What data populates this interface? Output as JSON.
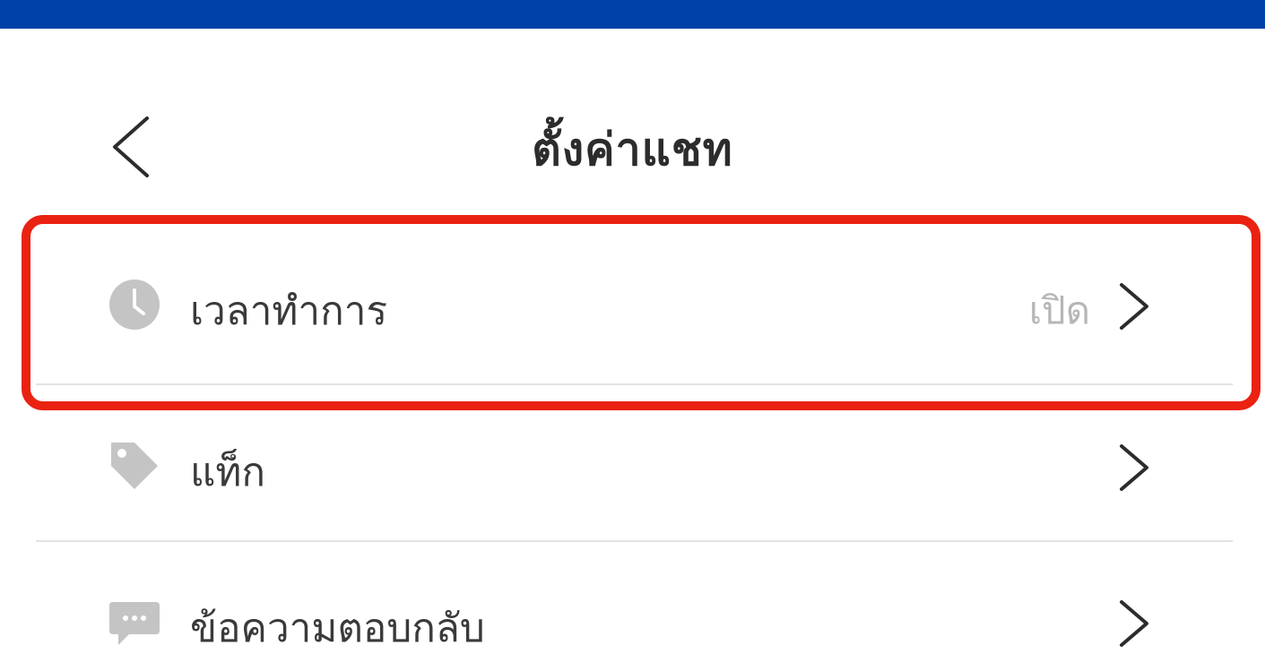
{
  "header": {
    "title": "ตั้งค่าแชท",
    "back_icon": "chevron-left-icon"
  },
  "settings": {
    "items": [
      {
        "label": "เวลาทำการ",
        "value": "เปิด",
        "icon": "clock-icon"
      },
      {
        "label": "แท็ก",
        "value": "",
        "icon": "tag-icon"
      },
      {
        "label": "ข้อความตอบกลับ",
        "value": "",
        "icon": "chat-bubble-icon"
      }
    ]
  },
  "colors": {
    "top_bar": "#0041a8",
    "highlight": "#ea2211",
    "icon_gray": "#c4c4c4",
    "value_gray": "#b6b6b6"
  }
}
